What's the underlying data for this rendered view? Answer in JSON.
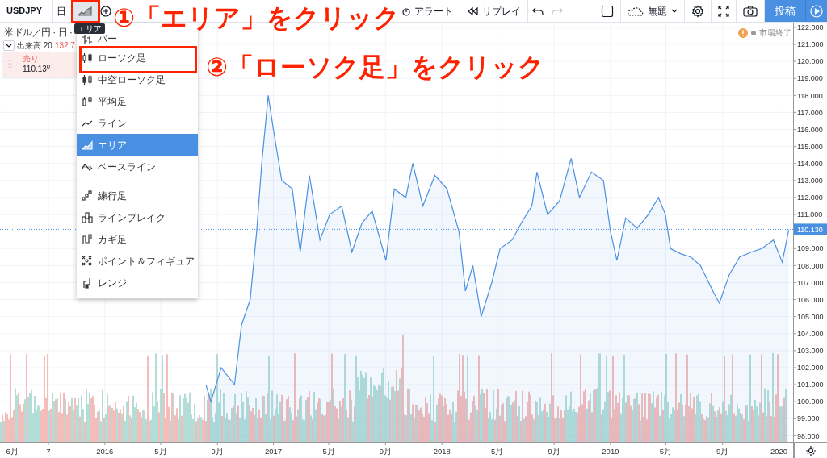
{
  "toolbar": {
    "symbol": "USDJPY",
    "interval": "日",
    "chart_type_button": {
      "tooltip": "エリア",
      "selected": true
    },
    "buttons": [
      {
        "kind": "alert",
        "label": "アラート"
      },
      {
        "kind": "replay",
        "label": "リプレイ"
      }
    ],
    "history": [
      {
        "kind": "undo",
        "disabled": false
      },
      {
        "kind": "redo",
        "disabled": true
      }
    ],
    "layout_name": "無題",
    "publish_button": "投稿"
  },
  "legend": {
    "title": "米ドル／円 · 日 ·",
    "volume_label": "出来高 20",
    "volume_value": "132.7"
  },
  "order_box": {
    "label": "売り",
    "price": "110.13$^{0}$"
  },
  "market_status": "市場終了",
  "chart_type_menu": {
    "groups": [
      [
        {
          "kind": "bar",
          "label": "バー",
          "selected": false
        },
        {
          "kind": "candles",
          "label": "ローソク足",
          "selected": false
        },
        {
          "kind": "hollow",
          "label": "中空ローソク足",
          "selected": false
        },
        {
          "kind": "heikin",
          "label": "平均足",
          "selected": false
        },
        {
          "kind": "line",
          "label": "ライン",
          "selected": false
        },
        {
          "kind": "area",
          "label": "エリア",
          "selected": true
        },
        {
          "kind": "baseline",
          "label": "ベースライン",
          "selected": false
        }
      ],
      [
        {
          "kind": "renko",
          "label": "練行足",
          "selected": false
        },
        {
          "kind": "linebreak",
          "label": "ラインブレイク",
          "selected": false
        },
        {
          "kind": "kagi",
          "label": "カギ足",
          "selected": false
        },
        {
          "kind": "pnf",
          "label": "ポイント＆フィギュア",
          "selected": false
        },
        {
          "kind": "range",
          "label": "レンジ",
          "selected": false
        }
      ]
    ]
  },
  "chart": {
    "chart_data": {
      "type": "area",
      "grid": true,
      "xlim": [
        "2015-05-19",
        "2020-04-14"
      ],
      "ylim": [
        97.64,
        122.28
      ],
      "xticks": [
        {
          "value": "2015-06-01",
          "label": "6月"
        },
        {
          "value": "2015-09-01",
          "label": "7"
        },
        {
          "value": "2016-01-01",
          "label": "2016"
        },
        {
          "value": "2016-05-01",
          "label": "5月"
        },
        {
          "value": "2016-09-01",
          "label": "9月"
        },
        {
          "value": "2017-01-01",
          "label": "2017"
        },
        {
          "value": "2017-05-01",
          "label": "5月"
        },
        {
          "value": "2017-09-01",
          "label": "9月"
        },
        {
          "value": "2018-01-01",
          "label": "2018"
        },
        {
          "value": "2018-05-01",
          "label": "5月"
        },
        {
          "value": "2018-09-01",
          "label": "9月"
        },
        {
          "value": "2019-01-01",
          "label": "2019"
        },
        {
          "value": "2019-05-01",
          "label": "5月"
        },
        {
          "value": "2019-09-01",
          "label": "9月"
        },
        {
          "value": "2020-01-01",
          "label": "2020"
        }
      ],
      "yticks": [
        {
          "value": 122,
          "label": "122.000"
        },
        {
          "value": 121,
          "label": "121.000"
        },
        {
          "value": 120,
          "label": "120.000"
        },
        {
          "value": 119,
          "label": "119.000"
        },
        {
          "value": 118,
          "label": "118.000"
        },
        {
          "value": 117,
          "label": "117.000"
        },
        {
          "value": 116,
          "label": "116.000"
        },
        {
          "value": 115,
          "label": "115.000"
        },
        {
          "value": 114,
          "label": "114.000"
        },
        {
          "value": 113,
          "label": "113.000"
        },
        {
          "value": 112,
          "label": "112.000"
        },
        {
          "value": 111,
          "label": "111.000"
        },
        {
          "value": 109,
          "label": "109.000"
        },
        {
          "value": 108,
          "label": "108.000"
        },
        {
          "value": 107,
          "label": "107.000"
        },
        {
          "value": 106,
          "label": "106.000"
        },
        {
          "value": 105,
          "label": "105.000"
        },
        {
          "value": 104,
          "label": "104.000"
        },
        {
          "value": 103,
          "label": "103.000"
        },
        {
          "value": 102,
          "label": "102.000"
        },
        {
          "value": 101,
          "label": "101.000"
        },
        {
          "value": 100,
          "label": "100.000"
        },
        {
          "value": 99,
          "label": "99.000"
        },
        {
          "value": 98,
          "label": "98.000"
        }
      ],
      "ref_lines": [
        {
          "axis": "y",
          "value": 110.13,
          "label": "110.130",
          "color": "#4a90e2"
        }
      ],
      "x": [
        "2016-08-07",
        "2016-08-18",
        "2016-09-09",
        "2016-10-08",
        "2016-10-23",
        "2016-11-11",
        "2016-11-25",
        "2016-12-06",
        "2016-12-20",
        "2017-01-01",
        "2017-01-19",
        "2017-02-11",
        "2017-02-28",
        "2017-03-20",
        "2017-04-12",
        "2017-05-03",
        "2017-05-29",
        "2017-06-20",
        "2017-07-12",
        "2017-08-03",
        "2017-09-02",
        "2017-09-20",
        "2017-10-15",
        "2017-10-30",
        "2017-11-21",
        "2017-12-17",
        "2018-01-12",
        "2018-02-07",
        "2018-02-21",
        "2018-03-09",
        "2018-03-27",
        "2018-04-19",
        "2018-05-07",
        "2018-06-02",
        "2018-06-24",
        "2018-07-15",
        "2018-07-26",
        "2018-08-18",
        "2018-09-13",
        "2018-10-08",
        "2018-10-26",
        "2018-11-21",
        "2018-12-17",
        "2019-01-01",
        "2019-01-15",
        "2019-02-03",
        "2019-02-28",
        "2019-03-24",
        "2019-04-15",
        "2019-04-30",
        "2019-05-11",
        "2019-06-02",
        "2019-06-24",
        "2019-07-15",
        "2019-08-11",
        "2019-08-25",
        "2019-09-16",
        "2019-10-08",
        "2019-11-03",
        "2019-11-25",
        "2019-12-20",
        "2020-01-08",
        "2020-01-22"
      ],
      "series": [
        {
          "color": "#4a90e2",
          "values": [
            101,
            100,
            102,
            101,
            104.5,
            106,
            110,
            114,
            118,
            116,
            113,
            112.5,
            108.8,
            113.3,
            109.5,
            111,
            111.5,
            108.8,
            110.5,
            111.2,
            108.3,
            112.5,
            112,
            114,
            111.5,
            113.3,
            112.5,
            110,
            106.5,
            108,
            105,
            107,
            109,
            109.5,
            110.6,
            111.5,
            113.5,
            111,
            111.8,
            114.3,
            112,
            113.5,
            113,
            110,
            108.3,
            110.8,
            110.2,
            111,
            112,
            111,
            109,
            108.7,
            108.5,
            108,
            106.5,
            105.8,
            107.5,
            108.5,
            108.8,
            109,
            109.5,
            108.2,
            110.1
          ]
        }
      ]
    }
  },
  "annotations": [
    {
      "text": "①「エリア」をクリック"
    },
    {
      "text": "②「ローソク足」をクリック"
    }
  ]
}
